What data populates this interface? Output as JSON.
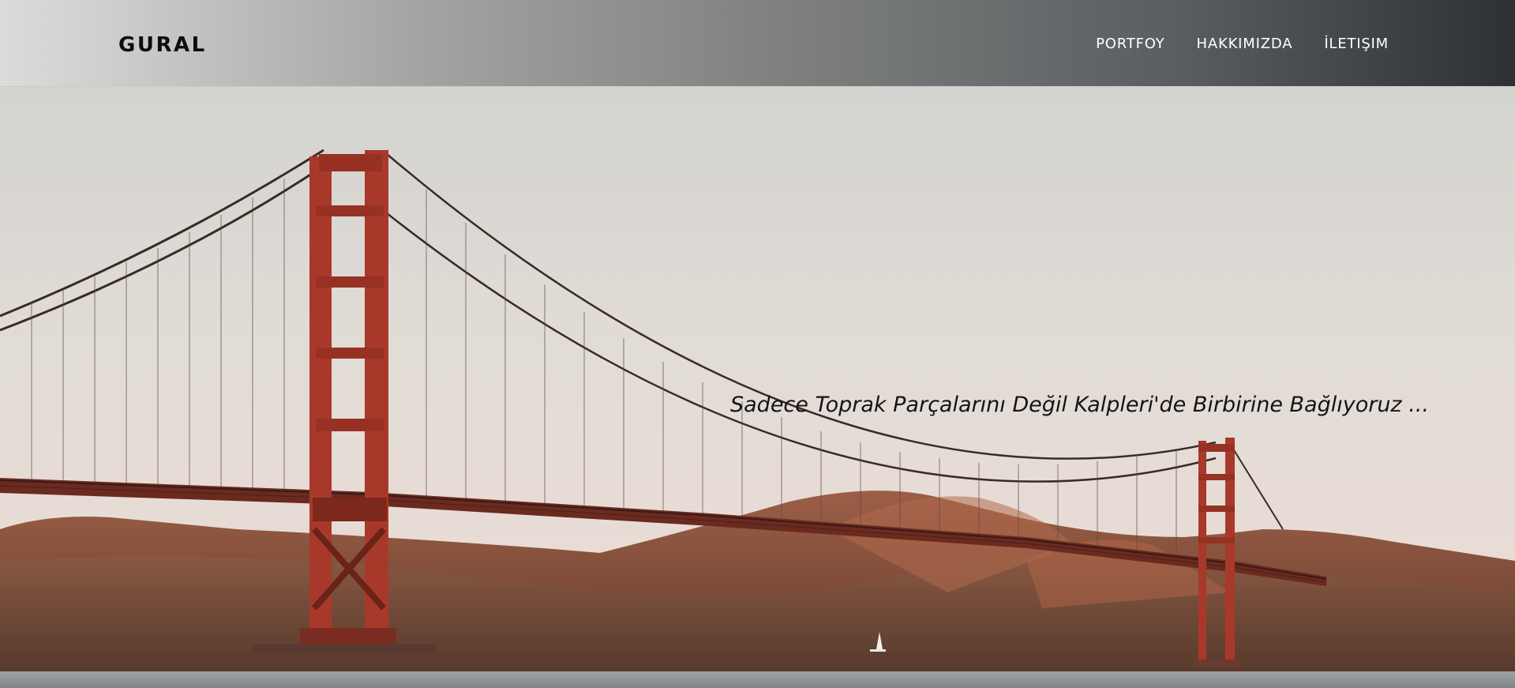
{
  "navbar": {
    "brand": "GURAL",
    "links": [
      {
        "label": "PORTFOY"
      },
      {
        "label": "HAKKIMIZDA"
      },
      {
        "label": "İLETIŞIM"
      }
    ]
  },
  "hero": {
    "tagline": "Sadece Toprak Parçalarını Değil Kalpleri'de Birbirine Bağlıyoruz ...",
    "image": "golden-gate-bridge-photo"
  },
  "colors": {
    "navbar_gradient_start": "#dcdcda",
    "navbar_gradient_end": "#2d3135",
    "brand_text": "#0d0d0d",
    "nav_text": "#ffffff",
    "bridge_red": "#a8392a",
    "sky": "#ddd8d2"
  }
}
